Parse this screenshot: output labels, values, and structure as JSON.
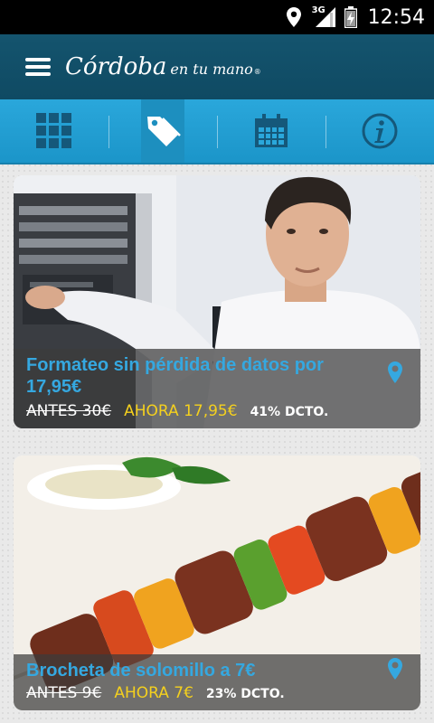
{
  "status_bar": {
    "time": "12:54",
    "network": "3G",
    "icons": [
      "location-icon",
      "signal-icon",
      "battery-icon"
    ]
  },
  "app_bar": {
    "menu_icon": "hamburger-icon",
    "brand_main": "Córdoba",
    "brand_sub": "en tu mano",
    "brand_mark": "®"
  },
  "tabs": [
    {
      "name": "grid-icon",
      "active": false
    },
    {
      "name": "tag-icon",
      "active": true
    },
    {
      "name": "calendar-icon",
      "active": false
    },
    {
      "name": "info-icon",
      "active": false
    }
  ],
  "offers": [
    {
      "title": "Formateo sin pérdida de datos por 17,95€",
      "before": "ANTES 30€",
      "now": "AHORA 17,95€",
      "discount": "41% DCTO."
    },
    {
      "title": "Brocheta de solomillo a 7€",
      "before": "ANTES 9€",
      "now": "AHORA 7€",
      "discount": "23% DCTO."
    }
  ],
  "colors": {
    "status_bar": "#000000",
    "app_bar": "#14546e",
    "tab_bar": "#2aa7db",
    "title_blue": "#35a8e0",
    "price_yellow": "#f4d01e"
  }
}
